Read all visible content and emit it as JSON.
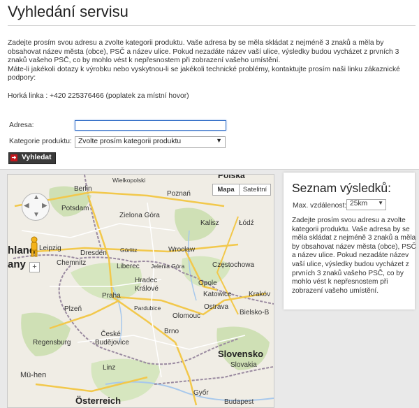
{
  "page": {
    "title": "Vyhledání servisu",
    "intro_line1": "Zadejte prosím svou adresu a zvolte kategorii produktu. Vaše adresa by se měla skládat z nejméně 3 znaků a měla by obsahovat název města (obce), PSČ a název ulice. Pokud nezadáte název vaší ulice, výsledky budou vycházet z prvních 3 znaků vašeho PSČ, co by mohlo vést k nepřesnostem při zobrazení vašeho umístění.",
    "intro_line2": "Máte-li jakékoli dotazy k výrobku nebo vyskytnou-li se jakékoli technické problémy, kontaktujte prosím naši linku zákaznické podpory:",
    "hotline": "Horká linka : +420 225376466 (poplatek za místní hovor)"
  },
  "form": {
    "address_label": "Adresa:",
    "address_value": "",
    "category_label": "Kategorie produktu:",
    "category_selected": "Zvolte prosím kategorii produktu",
    "search_label": "Vyhledat",
    "search_icon": "arrow-right-icon"
  },
  "map": {
    "type_map": "Mapa",
    "type_satellite": "Satelitní",
    "labels": {
      "polska": "Polska",
      "berlin": "Berlin",
      "wielkopolski": "Wielkopolski",
      "potsdam": "Potsdam",
      "poznan": "Poznań",
      "zielona_gora": "Zielona Góra",
      "kalisz": "Kalisz",
      "lodz": "Łódź",
      "hland": "hland",
      "any": "any",
      "leipzig": "Leipzig",
      "dresden": "Dresden",
      "wroclaw": "Wrocław",
      "chemnitz": "Chemnitz",
      "gorlitz": "Görlitz",
      "liberec": "Liberec",
      "jelenia_gora": "Jelenia Góra",
      "czestochowa": "Częstochowa",
      "opole": "Opole",
      "hradec": "Hradec Králové",
      "katowice": "Katowice",
      "krakow": "Krakóv",
      "praha": "Praha",
      "pardubice": "Pardubice",
      "ostrava": "Ostrava",
      "plzen": "Plzeň",
      "olomouc": "Olomouc",
      "bielsko": "Bielsko-B",
      "regensburg": "Regensburg",
      "ceske_budejovice": "České Budějovice",
      "brno": "Brno",
      "slovensko": "Slovensko",
      "slovakia": "Slovakia",
      "linz": "Linz",
      "munchen": "Mü-hen",
      "osterreich": "Österreich",
      "gyor": "Győr",
      "budapest": "Budapest"
    }
  },
  "results": {
    "title": "Seznam výsledků:",
    "max_distance_label": "Max. vzdálenost:",
    "max_distance_value": "25km",
    "text": "Zadejte prosím svou adresu a zvolte kategorii produktu. Vaše adresa by se měla skládat z nejméně 3 znaků a měla by obsahovat název města (obce), PSČ a název ulice. Pokud nezadáte název vaší ulice, výsledky budou vycházet z prvních 3 znaků vašeho PSČ, co by mohlo vést k nepřesnostem při zobrazení vašeho umístění."
  },
  "colors": {
    "brand_red": "#c4161c",
    "button_dark": "#3a3a3a",
    "focus_blue": "#3b74c9",
    "map_land": "#f0ede5",
    "map_forest": "#cfe0b5",
    "map_highway": "#f2c84b",
    "map_border": "#9a8aa0"
  }
}
